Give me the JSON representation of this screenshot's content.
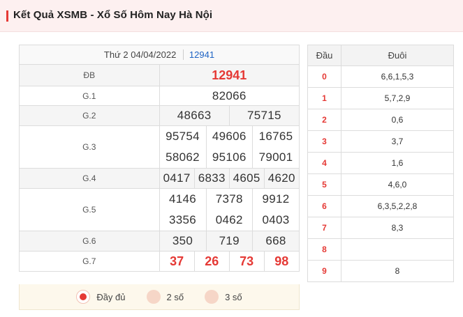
{
  "header": {
    "title": "Kết Quả XSMB - Xổ Số Hôm Nay Hà Nội"
  },
  "results": {
    "date": "Thứ 2 04/04/2022",
    "code": "12941",
    "special": {
      "label": "ĐB",
      "value": "12941"
    },
    "g1": {
      "label": "G.1",
      "values": [
        "82066"
      ]
    },
    "g2": {
      "label": "G.2",
      "values": [
        "48663",
        "75715"
      ]
    },
    "g3": {
      "label": "G.3",
      "values": [
        "95754",
        "49606",
        "16765",
        "58062",
        "95106",
        "79001"
      ]
    },
    "g4": {
      "label": "G.4",
      "values": [
        "0417",
        "6833",
        "4605",
        "4620"
      ]
    },
    "g5": {
      "label": "G.5",
      "values": [
        "4146",
        "7378",
        "9912",
        "3356",
        "0462",
        "0403"
      ]
    },
    "g6": {
      "label": "G.6",
      "values": [
        "350",
        "719",
        "668"
      ]
    },
    "g7": {
      "label": "G.7",
      "values": [
        "37",
        "26",
        "73",
        "98"
      ]
    }
  },
  "options": {
    "full": "Đầy đủ",
    "two": "2 số",
    "three": "3 số",
    "selected": "full"
  },
  "loto": {
    "head_label": "Đầu",
    "tail_label": "Đuôi",
    "rows": [
      {
        "head": "0",
        "tails": "6,6,1,5,3"
      },
      {
        "head": "1",
        "tails": "5,7,2,9"
      },
      {
        "head": "2",
        "tails": "0,6"
      },
      {
        "head": "3",
        "tails": "3,7"
      },
      {
        "head": "4",
        "tails": "1,6"
      },
      {
        "head": "5",
        "tails": "4,6,0"
      },
      {
        "head": "6",
        "tails": "6,3,5,2,2,8"
      },
      {
        "head": "7",
        "tails": "8,3"
      },
      {
        "head": "8",
        "tails": ""
      },
      {
        "head": "9",
        "tails": "8"
      }
    ]
  },
  "colors": {
    "accent": "#e53935",
    "link": "#1e63c4",
    "option_bg": "#fdf8ec"
  }
}
